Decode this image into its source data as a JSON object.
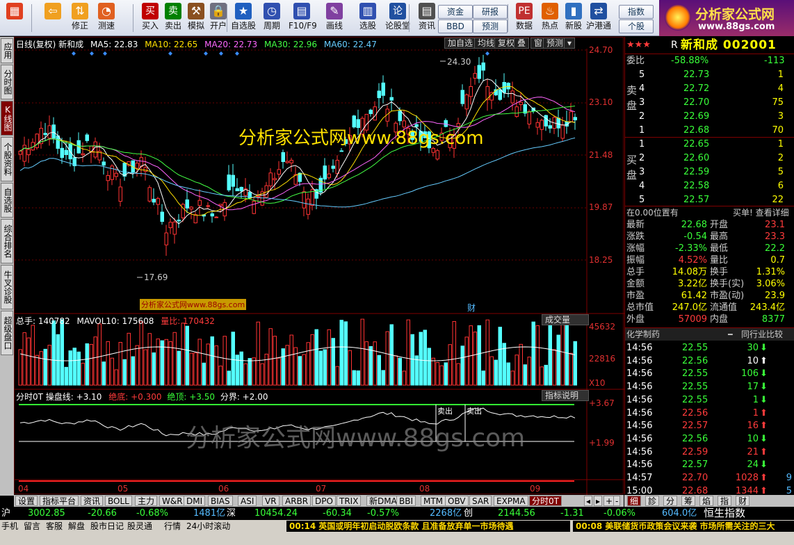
{
  "toolbar": {
    "buttons": [
      {
        "label": "",
        "icon": "menu-grid-icon"
      },
      {
        "label": "",
        "icon": "back-arrow-icon"
      },
      {
        "label": "修正",
        "icon": "adjust-icon"
      },
      {
        "label": "测速",
        "icon": "clock-icon"
      },
      {
        "label": "买入",
        "icon": "buy-icon",
        "glyph": "买"
      },
      {
        "label": "卖出",
        "icon": "sell-icon",
        "glyph": "卖"
      },
      {
        "label": "模拟",
        "icon": "gavel-icon"
      },
      {
        "label": "开户",
        "icon": "lock-icon"
      },
      {
        "label": "自选股",
        "icon": "star-icon"
      },
      {
        "label": "周期",
        "icon": "period-icon"
      },
      {
        "label": "F10/F9",
        "icon": "f10-icon"
      },
      {
        "label": "画线",
        "icon": "pencil-icon"
      },
      {
        "label": "选股",
        "icon": "chart-select-icon"
      },
      {
        "label": "论股堂",
        "icon": "forum-icon",
        "glyph": "论"
      },
      {
        "label": "资讯",
        "icon": "doc-icon"
      },
      {
        "label": "数据",
        "icon": "pe-icon",
        "glyph": "PE"
      },
      {
        "label": "热点",
        "icon": "hot-icon"
      },
      {
        "label": "新股",
        "icon": "phone-icon"
      },
      {
        "label": "沪港通",
        "icon": "sse-hk-icon"
      }
    ],
    "mini": [
      "资金",
      "BBD",
      "研报",
      "预测",
      "指数",
      "个股"
    ]
  },
  "logo": {
    "title": "分析家公式网",
    "url": "www.88gs.com"
  },
  "left_tabs": [
    "应用",
    "分时图",
    "K线图",
    "个股资料",
    "自选股",
    "综合排名",
    "牛叉诊股",
    "超级盘口"
  ],
  "kline": {
    "header": {
      "label": "日线(复权) 新和成",
      "ma5": "MA5: 22.83",
      "ma10": "MA10: 22.65",
      "ma20": "MA20: 22.73",
      "ma30": "MA30: 22.96",
      "ma60": "MA60: 22.47"
    },
    "buttons": [
      "加自选",
      "均线",
      "复权",
      "叠",
      "窗",
      "预测"
    ],
    "price_axis": [
      "24.70",
      "23.10",
      "21.48",
      "19.87",
      "18.25"
    ],
    "high_label": "24.30",
    "low_label": "17.69",
    "watermark": "分析家公式网www.88gs.com",
    "small_watermark": "分析家公式网www.88gs.com",
    "cai": "财"
  },
  "volume": {
    "header": {
      "total": "总手: 140782",
      "mavol": "MAVOL10: 175608",
      "ratio": "量比: 170432"
    },
    "button": "成交量",
    "axis": [
      "45632",
      "22816",
      "X10"
    ]
  },
  "indicator": {
    "header": {
      "name": "分时0T 操盘线: +3.10",
      "jd": "绝底: +0.300",
      "jt": "绝顶: +3.50",
      "fj": "分界: +2.00"
    },
    "button": "指标说明",
    "axis": [
      "+3.67",
      "+1.99"
    ],
    "sell_labels": [
      "卖出",
      "卖出"
    ],
    "watermark": "分析家公式网www.88gs.com"
  },
  "date_axis": [
    "04",
    "05",
    "06",
    "07",
    "08",
    "09"
  ],
  "right": {
    "code_title": "新和成 002001",
    "stars": "★★★",
    "r": "R",
    "weibi": {
      "label": "委比",
      "pct": "-58.88%",
      "val": "-113"
    },
    "sell_label": "卖盘",
    "buy_label": "买盘",
    "asks": [
      [
        "5",
        "22.73",
        "1"
      ],
      [
        "4",
        "22.72",
        "4"
      ],
      [
        "3",
        "22.70",
        "75"
      ],
      [
        "2",
        "22.69",
        "3"
      ],
      [
        "1",
        "22.68",
        "70"
      ]
    ],
    "bids": [
      [
        "1",
        "22.65",
        "1"
      ],
      [
        "2",
        "22.60",
        "2"
      ],
      [
        "3",
        "22.59",
        "5"
      ],
      [
        "4",
        "22.58",
        "6"
      ],
      [
        "5",
        "22.57",
        "22"
      ]
    ],
    "info_line": "在0.00位置有",
    "info_link": "买单! 查看详细",
    "stats": [
      [
        "最新",
        "22.68",
        "开盘",
        "23.1"
      ],
      [
        "涨跌",
        "-0.54",
        "最高",
        "23.3"
      ],
      [
        "涨幅",
        "-2.33%",
        "最低",
        "22.2"
      ],
      [
        "振幅",
        "4.52%",
        "量比",
        "0.7"
      ],
      [
        "总手",
        "14.08万",
        "换手",
        "1.31%"
      ],
      [
        "金额",
        "3.22亿",
        "换手(实)",
        "3.06%"
      ],
      [
        "市盈",
        "61.42",
        "市盈(动)",
        "23.9"
      ],
      [
        "总市值",
        "247.0亿",
        "流通值",
        "243.4亿"
      ],
      [
        "外盘",
        "57009",
        "内盘",
        "8377"
      ]
    ],
    "industry": "化学制药",
    "industry_link": "同行业比较",
    "ticks": [
      [
        "14:56",
        "22.55",
        "30",
        "dn"
      ],
      [
        "14:56",
        "22.56",
        "10",
        "wh"
      ],
      [
        "14:56",
        "22.55",
        "106",
        "dn"
      ],
      [
        "14:56",
        "22.55",
        "17",
        "dn"
      ],
      [
        "14:56",
        "22.55",
        "1",
        "dn"
      ],
      [
        "14:56",
        "22.56",
        "1",
        "up"
      ],
      [
        "14:56",
        "22.57",
        "16",
        "up"
      ],
      [
        "14:56",
        "22.56",
        "10",
        "dn"
      ],
      [
        "14:56",
        "22.59",
        "21",
        "up"
      ],
      [
        "14:56",
        "22.57",
        "24",
        "dn"
      ],
      [
        "14:57",
        "22.70",
        "1028",
        "up"
      ],
      [
        "15:00",
        "22.68",
        "1344",
        "up"
      ]
    ],
    "tick_extra": [
      "",
      "",
      "",
      "",
      "",
      "",
      "",
      "",
      "",
      "",
      "9",
      "5"
    ],
    "bottom_tabs": [
      "细",
      "診",
      "分",
      "筹",
      "焰",
      "指",
      "财"
    ]
  },
  "bottom_tabs": [
    "设置",
    "指标平台",
    "资讯",
    "BOLL",
    "主力",
    "W&R",
    "DMI",
    "BIAS",
    "ASI",
    "VR",
    "ARBR",
    "DPO",
    "TRIX",
    "新DMA",
    "BBI",
    "MTM",
    "OBV",
    "SAR",
    "EXPMA",
    "分时0T"
  ],
  "index_bar": {
    "sh": {
      "name": "沪",
      "val": "3002.85",
      "chg": "-20.66",
      "pct": "-0.68%",
      "amt": "1481亿"
    },
    "sz": {
      "name": "深",
      "val": "10454.24",
      "chg": "-60.34",
      "pct": "-0.57%",
      "amt": "2268亿"
    },
    "cy": {
      "name": "创",
      "val": "2144.56",
      "chg": "-1.31",
      "pct": "-0.06%",
      "amt": "604.0亿"
    },
    "hk": "恒生指数"
  },
  "news_tabs": [
    "手机",
    "留言",
    "客服",
    "解盘",
    "股市日记",
    "股灵通",
    "行情",
    "24小时滚动"
  ],
  "news": [
    "00:14 英国或明年初启动脱欧条款 且准备放弃单一市场待遇",
    "00:08 美联储货币政策会议来袭 市场所需关注的三大"
  ]
}
